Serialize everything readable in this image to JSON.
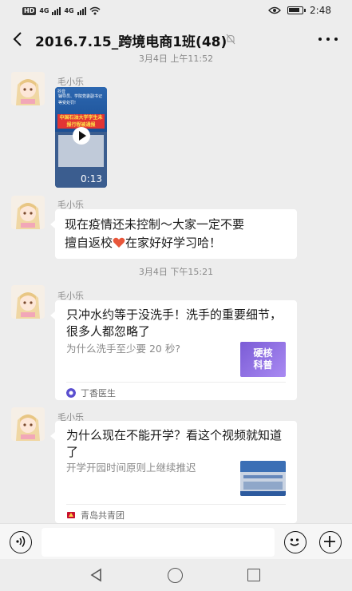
{
  "status_bar": {
    "network": "HD",
    "signal1": "4G",
    "signal2": "4G",
    "time": "2:48"
  },
  "header": {
    "title": "2016.7.15_跨境电商1班(48)"
  },
  "chat": {
    "timestamp_top": "3月4日 上午11:52",
    "timestamp_mid": "3月4日 下午15:21",
    "messages": [
      {
        "sender": "毛小乐",
        "video": {
          "app": "抖音",
          "headline": "辅导员、学院党委副书记等受处罚!",
          "banner": "中国石油大学学生未报行程被通报",
          "duration": "0:13"
        }
      },
      {
        "sender": "毛小乐",
        "text_line1": "现在疫情还未控制～大家一定不要",
        "text_line2_a": "擅自返校",
        "text_line2_b": "在家好好学习哈！"
      },
      {
        "sender": "毛小乐",
        "card": {
          "title": "只冲水约等于没洗手！洗手的重要细节，很多人都忽略了",
          "desc": "为什么洗手至少要 20 秒?",
          "thumb_text": "硬核\n科普",
          "source": "丁香医生"
        }
      },
      {
        "sender": "毛小乐",
        "card": {
          "title": "为什么现在不能开学？看这个视频就知道了",
          "desc": "开学开园时间原则上继续推迟",
          "source": "青岛共青团"
        }
      }
    ]
  },
  "colors": {
    "background": "#ededed",
    "bubble": "#ffffff",
    "meta": "#8a8a8a",
    "heart": "#e8563a"
  }
}
